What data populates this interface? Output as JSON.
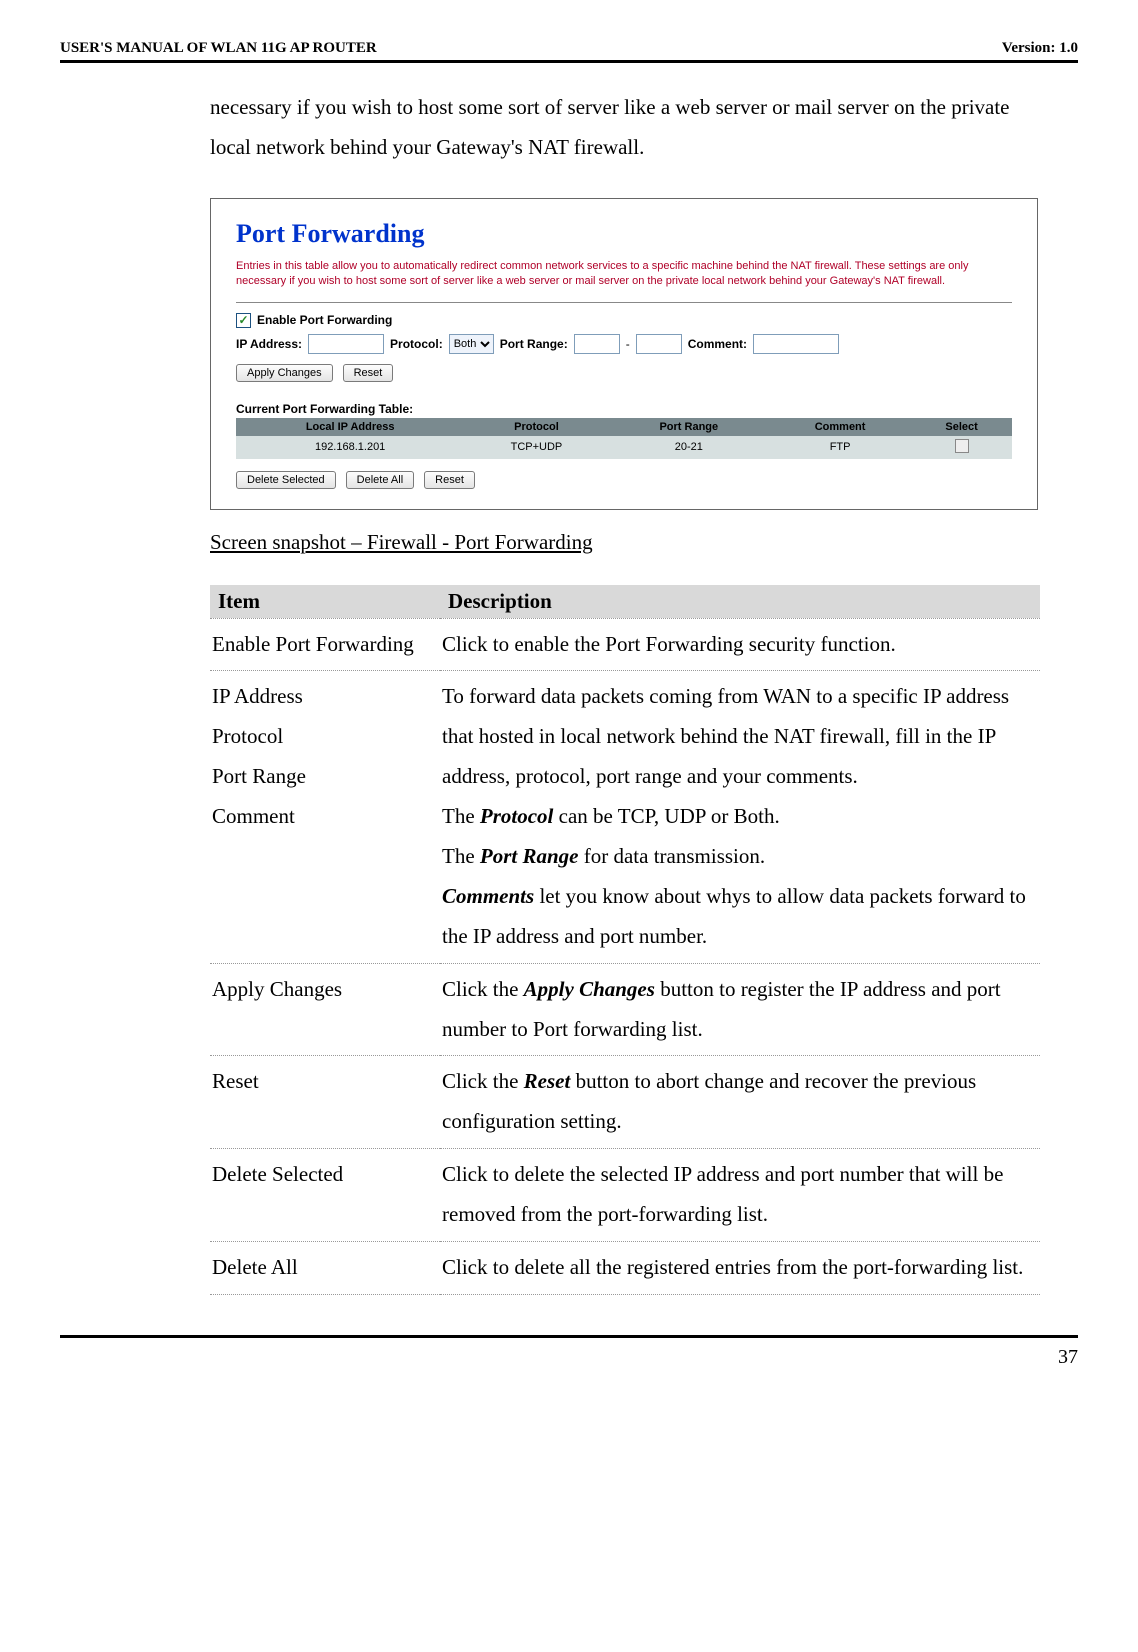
{
  "header": {
    "left": "USER'S MANUAL OF WLAN 11G AP ROUTER",
    "right": "Version: 1.0"
  },
  "intro_text": "necessary if you wish to host some sort of server like a web server or mail server on the private local network behind your Gateway's NAT firewall.",
  "screenshot": {
    "title": "Port Forwarding",
    "desc": "Entries in this table allow you to automatically redirect common network services to a specific machine behind the NAT firewall. These settings are only necessary if you wish to host some sort of server like a web server or mail server on the private local network behind your Gateway's NAT firewall.",
    "enable_label": "Enable Port Forwarding",
    "labels": {
      "ip": "IP Address:",
      "protocol": "Protocol:",
      "protocol_value": "Both",
      "port_range": "Port Range:",
      "port_sep": "-",
      "comment": "Comment:"
    },
    "buttons": {
      "apply": "Apply Changes",
      "reset": "Reset",
      "delete_selected": "Delete Selected",
      "delete_all": "Delete All",
      "reset2": "Reset"
    },
    "table_caption": "Current Port Forwarding Table:",
    "table": {
      "headers": [
        "Local IP Address",
        "Protocol",
        "Port Range",
        "Comment",
        "Select"
      ],
      "row": [
        "192.168.1.201",
        "TCP+UDP",
        "20-21",
        "FTP"
      ]
    }
  },
  "caption": "Screen snapshot – Firewall - Port Forwarding",
  "desc_table": {
    "header_item": "Item",
    "header_desc": "Description",
    "rows": {
      "r1_item": "Enable Port Forwarding",
      "r1_desc": "Click to enable the Port Forwarding security function.",
      "r2_items": [
        "IP Address",
        "Protocol",
        "Port Range",
        "Comment"
      ],
      "r2_line1": "To forward data packets coming from WAN to a specific IP address that hosted in local network behind the NAT firewall, fill in the IP address, protocol, port range and your comments.",
      "r2_line2a": "The ",
      "r2_line2b": "Protocol",
      "r2_line2c": " can be TCP, UDP or Both.",
      "r2_line3a": "The ",
      "r2_line3b": "Port Range",
      "r2_line3c": " for data transmission.",
      "r2_line4a": "Comments",
      "r2_line4b": " let you know about whys to allow data packets forward to the IP address and port number.",
      "r3_item": "Apply Changes",
      "r3a": "Click the ",
      "r3b": "Apply Changes",
      "r3c": " button to register the IP address and port number to Port forwarding list.",
      "r4_item": "Reset",
      "r4a": "Click the ",
      "r4b": "Reset",
      "r4c": " button to abort change and recover the previous configuration setting.",
      "r5_item": "Delete Selected",
      "r5_desc": "Click to delete the selected IP address and port number that will be removed from the port-forwarding list.",
      "r6_item": "Delete All",
      "r6_desc": "Click to delete all the registered entries from the port-forwarding list."
    }
  },
  "footer": {
    "page": "37"
  },
  "chart_data": {
    "type": "table",
    "title": "Current Port Forwarding Table",
    "columns": [
      "Local IP Address",
      "Protocol",
      "Port Range",
      "Comment",
      "Select"
    ],
    "rows": [
      [
        "192.168.1.201",
        "TCP+UDP",
        "20-21",
        "FTP",
        false
      ]
    ]
  }
}
